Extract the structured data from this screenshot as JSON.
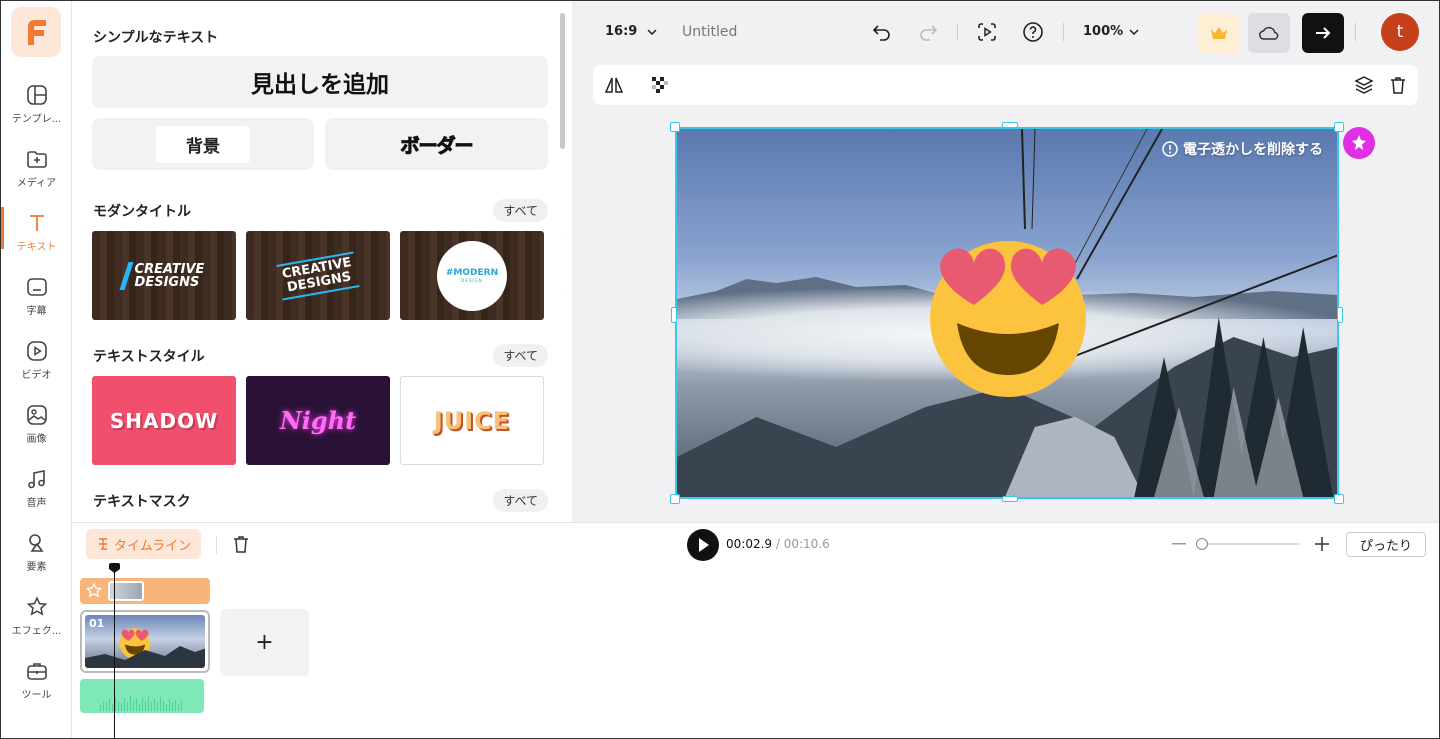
{
  "rail": {
    "items": [
      {
        "label": "テンプレ...",
        "icon": "template-icon"
      },
      {
        "label": "メディア",
        "icon": "media-add-icon"
      },
      {
        "label": "テキスト",
        "icon": "text-icon",
        "active": true
      },
      {
        "label": "字幕",
        "icon": "subtitle-icon"
      },
      {
        "label": "ビデオ",
        "icon": "video-icon"
      },
      {
        "label": "画像",
        "icon": "image-icon"
      },
      {
        "label": "音声",
        "icon": "music-icon"
      },
      {
        "label": "要素",
        "icon": "shapes-icon"
      },
      {
        "label": "エフェク...",
        "icon": "effects-icon"
      },
      {
        "label": "ツール",
        "icon": "toolbox-icon"
      }
    ],
    "accent": "#f07a35"
  },
  "panel": {
    "simple_title": "シンプルなテキスト",
    "add_heading": "見出しを追加",
    "background_label": "背景",
    "border_label": "ボーダー",
    "modern_title": "モダンタイトル",
    "style_title": "テキストスタイル",
    "mask_title": "テキストマスク",
    "all_label": "すべて",
    "modern_cards": [
      {
        "text1": "CREATIVE",
        "text2": "DESIGNS"
      },
      {
        "text1": "CREATIVE",
        "text2": "DESIGNS"
      },
      {
        "text1": "#MODERN",
        "text2": "DESIGN"
      }
    ],
    "style_cards": [
      "SHADOW",
      "Night",
      "JUICE"
    ]
  },
  "topbar": {
    "ratio": "16:9",
    "project_name": "Untitled",
    "zoom": "100%",
    "avatar_initial": "t"
  },
  "canvas": {
    "watermark_text": "電子透かしを削除する"
  },
  "timeline": {
    "timeline_label": "タイムライン",
    "current_time": "00:02.9",
    "duration": "/ 00:10.6",
    "fit_label": "ぴったり",
    "clip_number": "01",
    "add_label": "+"
  }
}
